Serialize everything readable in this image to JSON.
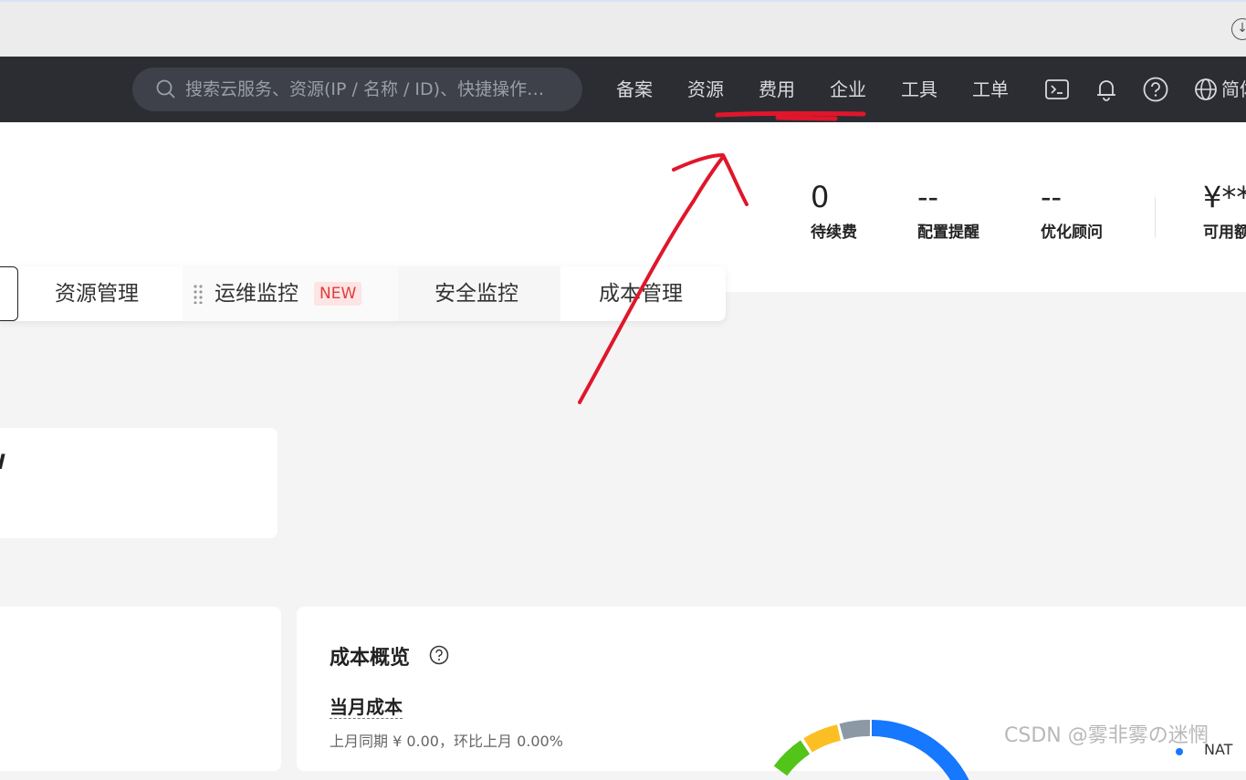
{
  "topnav": {
    "search_placeholder": "搜索云服务、资源(IP / 名称 / ID)、快捷操作…",
    "items": [
      "备案",
      "资源",
      "费用",
      "企业",
      "工具",
      "工单"
    ],
    "language": "简体"
  },
  "stats": [
    {
      "value": "0",
      "label": "待续费"
    },
    {
      "value": "--",
      "label": "配置提醒"
    },
    {
      "value": "--",
      "label": "优化顾问"
    },
    {
      "value": "¥**",
      "label": "可用额"
    }
  ],
  "tabs": {
    "items": [
      "资源管理",
      "运维监控",
      "安全监控",
      "成本管理"
    ],
    "new_badge": "NEW"
  },
  "left_card": {
    "text": "W"
  },
  "cost_card": {
    "title": "成本概览",
    "month_cost_label": "当月成本",
    "comparison": "上月同期 ¥ 0.00，环比上月  0.00%",
    "legend": [
      "NAT"
    ]
  },
  "watermark": "CSDN @雾非雾の迷惘",
  "colors": {
    "nav_bg": "#2b2d33",
    "new_badge": "#e23b3b",
    "donut_blue": "#1677ff",
    "donut_yellow": "#fbbf24",
    "donut_green": "#52c41a",
    "donut_gray": "#8c98a4",
    "annotation_red": "#e0162b"
  }
}
